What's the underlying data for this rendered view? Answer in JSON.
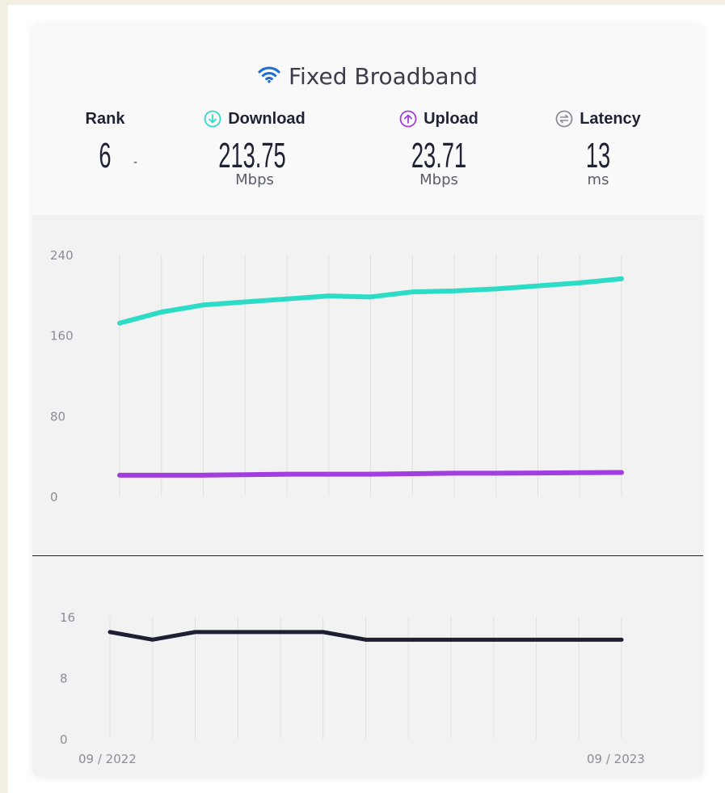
{
  "card": {
    "title": "Fixed Broadband",
    "icon": "wifi-icon",
    "accent_color": "#1f6fd0"
  },
  "metrics": {
    "rank": {
      "label": "Rank",
      "value": "6",
      "change": "-"
    },
    "download": {
      "label": "Download",
      "value": "213.75",
      "unit": "Mbps",
      "icon": "download-arrow-icon",
      "color": "#2ddcc6"
    },
    "upload": {
      "label": "Upload",
      "value": "23.71",
      "unit": "Mbps",
      "icon": "upload-arrow-icon",
      "color": "#a23de0"
    },
    "latency": {
      "label": "Latency",
      "value": "13",
      "unit": "ms",
      "icon": "latency-icon",
      "color": "#8a8d99"
    }
  },
  "chart_data": [
    {
      "type": "line",
      "x": [
        "09 / 2022",
        "",
        "",
        "",
        "",
        "",
        "",
        "",
        "",
        "",
        "",
        "",
        "09 / 2023"
      ],
      "ylim": [
        0,
        240
      ],
      "yticks": [
        "240",
        "160",
        "80",
        "0"
      ],
      "grid": true,
      "series": [
        {
          "values": [
            172,
            183,
            190,
            193,
            196,
            199,
            198,
            203,
            204,
            206,
            209,
            212,
            216
          ],
          "color": "#2ddcc6"
        },
        {
          "values": [
            21,
            21,
            21,
            21.5,
            22,
            22,
            22,
            22.5,
            23,
            23,
            23.2,
            23.5,
            23.71
          ],
          "color": "#a23de0"
        }
      ]
    },
    {
      "type": "line",
      "x": [
        "09 / 2022",
        "",
        "",
        "",
        "",
        "",
        "",
        "",
        "",
        "",
        "",
        "",
        "09 / 2023"
      ],
      "ylim": [
        0,
        16
      ],
      "yticks": [
        "16",
        "8",
        "0"
      ],
      "xtick_labels": [
        "09 / 2022",
        "09 / 2023"
      ],
      "grid": true,
      "series": [
        {
          "values": [
            14,
            13,
            14,
            14,
            14,
            14,
            13,
            13,
            13,
            13,
            13,
            13,
            13
          ],
          "color": "#1d2032"
        }
      ]
    }
  ]
}
